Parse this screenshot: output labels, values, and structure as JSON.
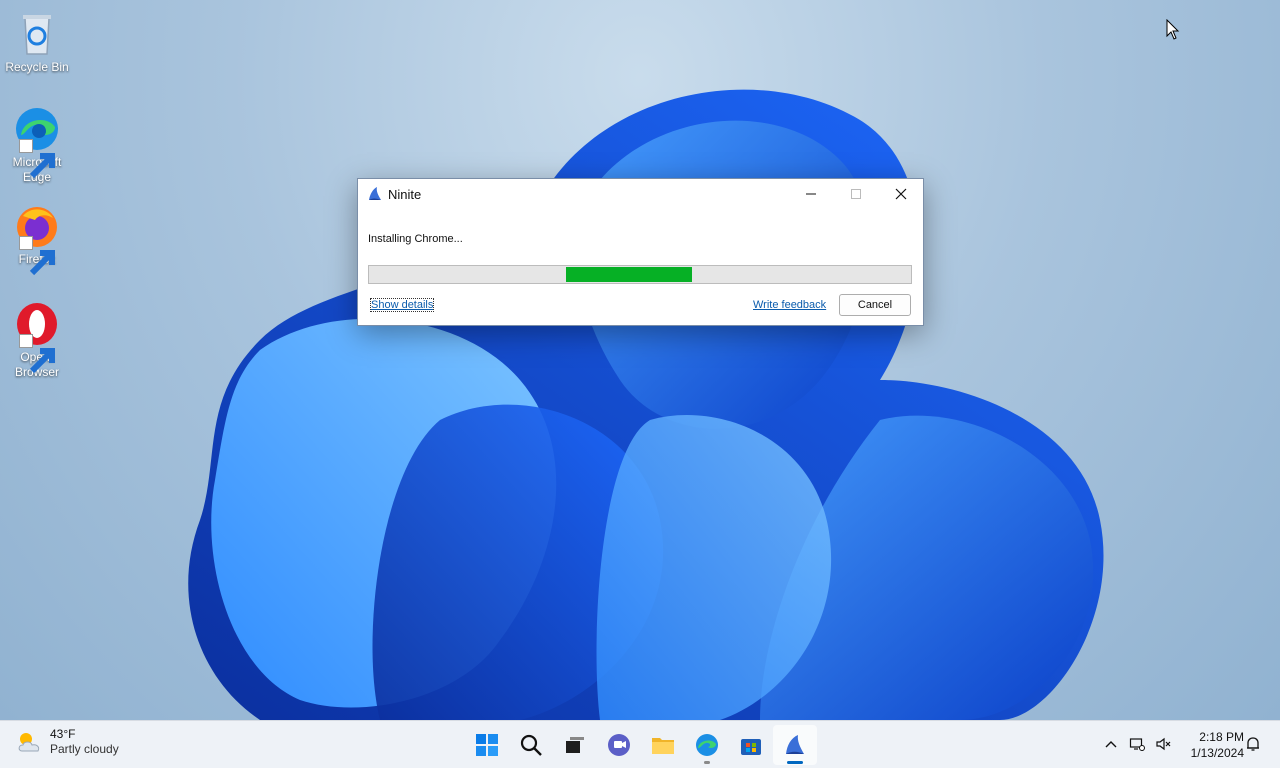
{
  "desktop": {
    "icons": [
      {
        "label": "Recycle Bin"
      },
      {
        "label": "Microsoft Edge"
      },
      {
        "label": "Firefox"
      },
      {
        "label": "Opera Browser"
      }
    ]
  },
  "window": {
    "title": "Ninite",
    "status": "Installing Chrome...",
    "progress": {
      "start_fraction": 0.363,
      "end_fraction": 0.596,
      "fill_color": "#06b025"
    },
    "show_details_label": "Show details",
    "write_feedback_label": "Write feedback",
    "cancel_label": "Cancel"
  },
  "taskbar": {
    "weather": {
      "temperature": "43°F",
      "condition": "Partly cloudy"
    },
    "apps": [
      "windows-start",
      "search",
      "task-view",
      "teams-chat",
      "file-explorer",
      "microsoft-edge",
      "microsoft-store",
      "ninite"
    ],
    "clock": {
      "time": "2:18 PM",
      "date": "1/13/2024"
    }
  },
  "colors": {
    "accent": "#0067c0",
    "link": "#0b5cad",
    "progress": "#06b025"
  }
}
